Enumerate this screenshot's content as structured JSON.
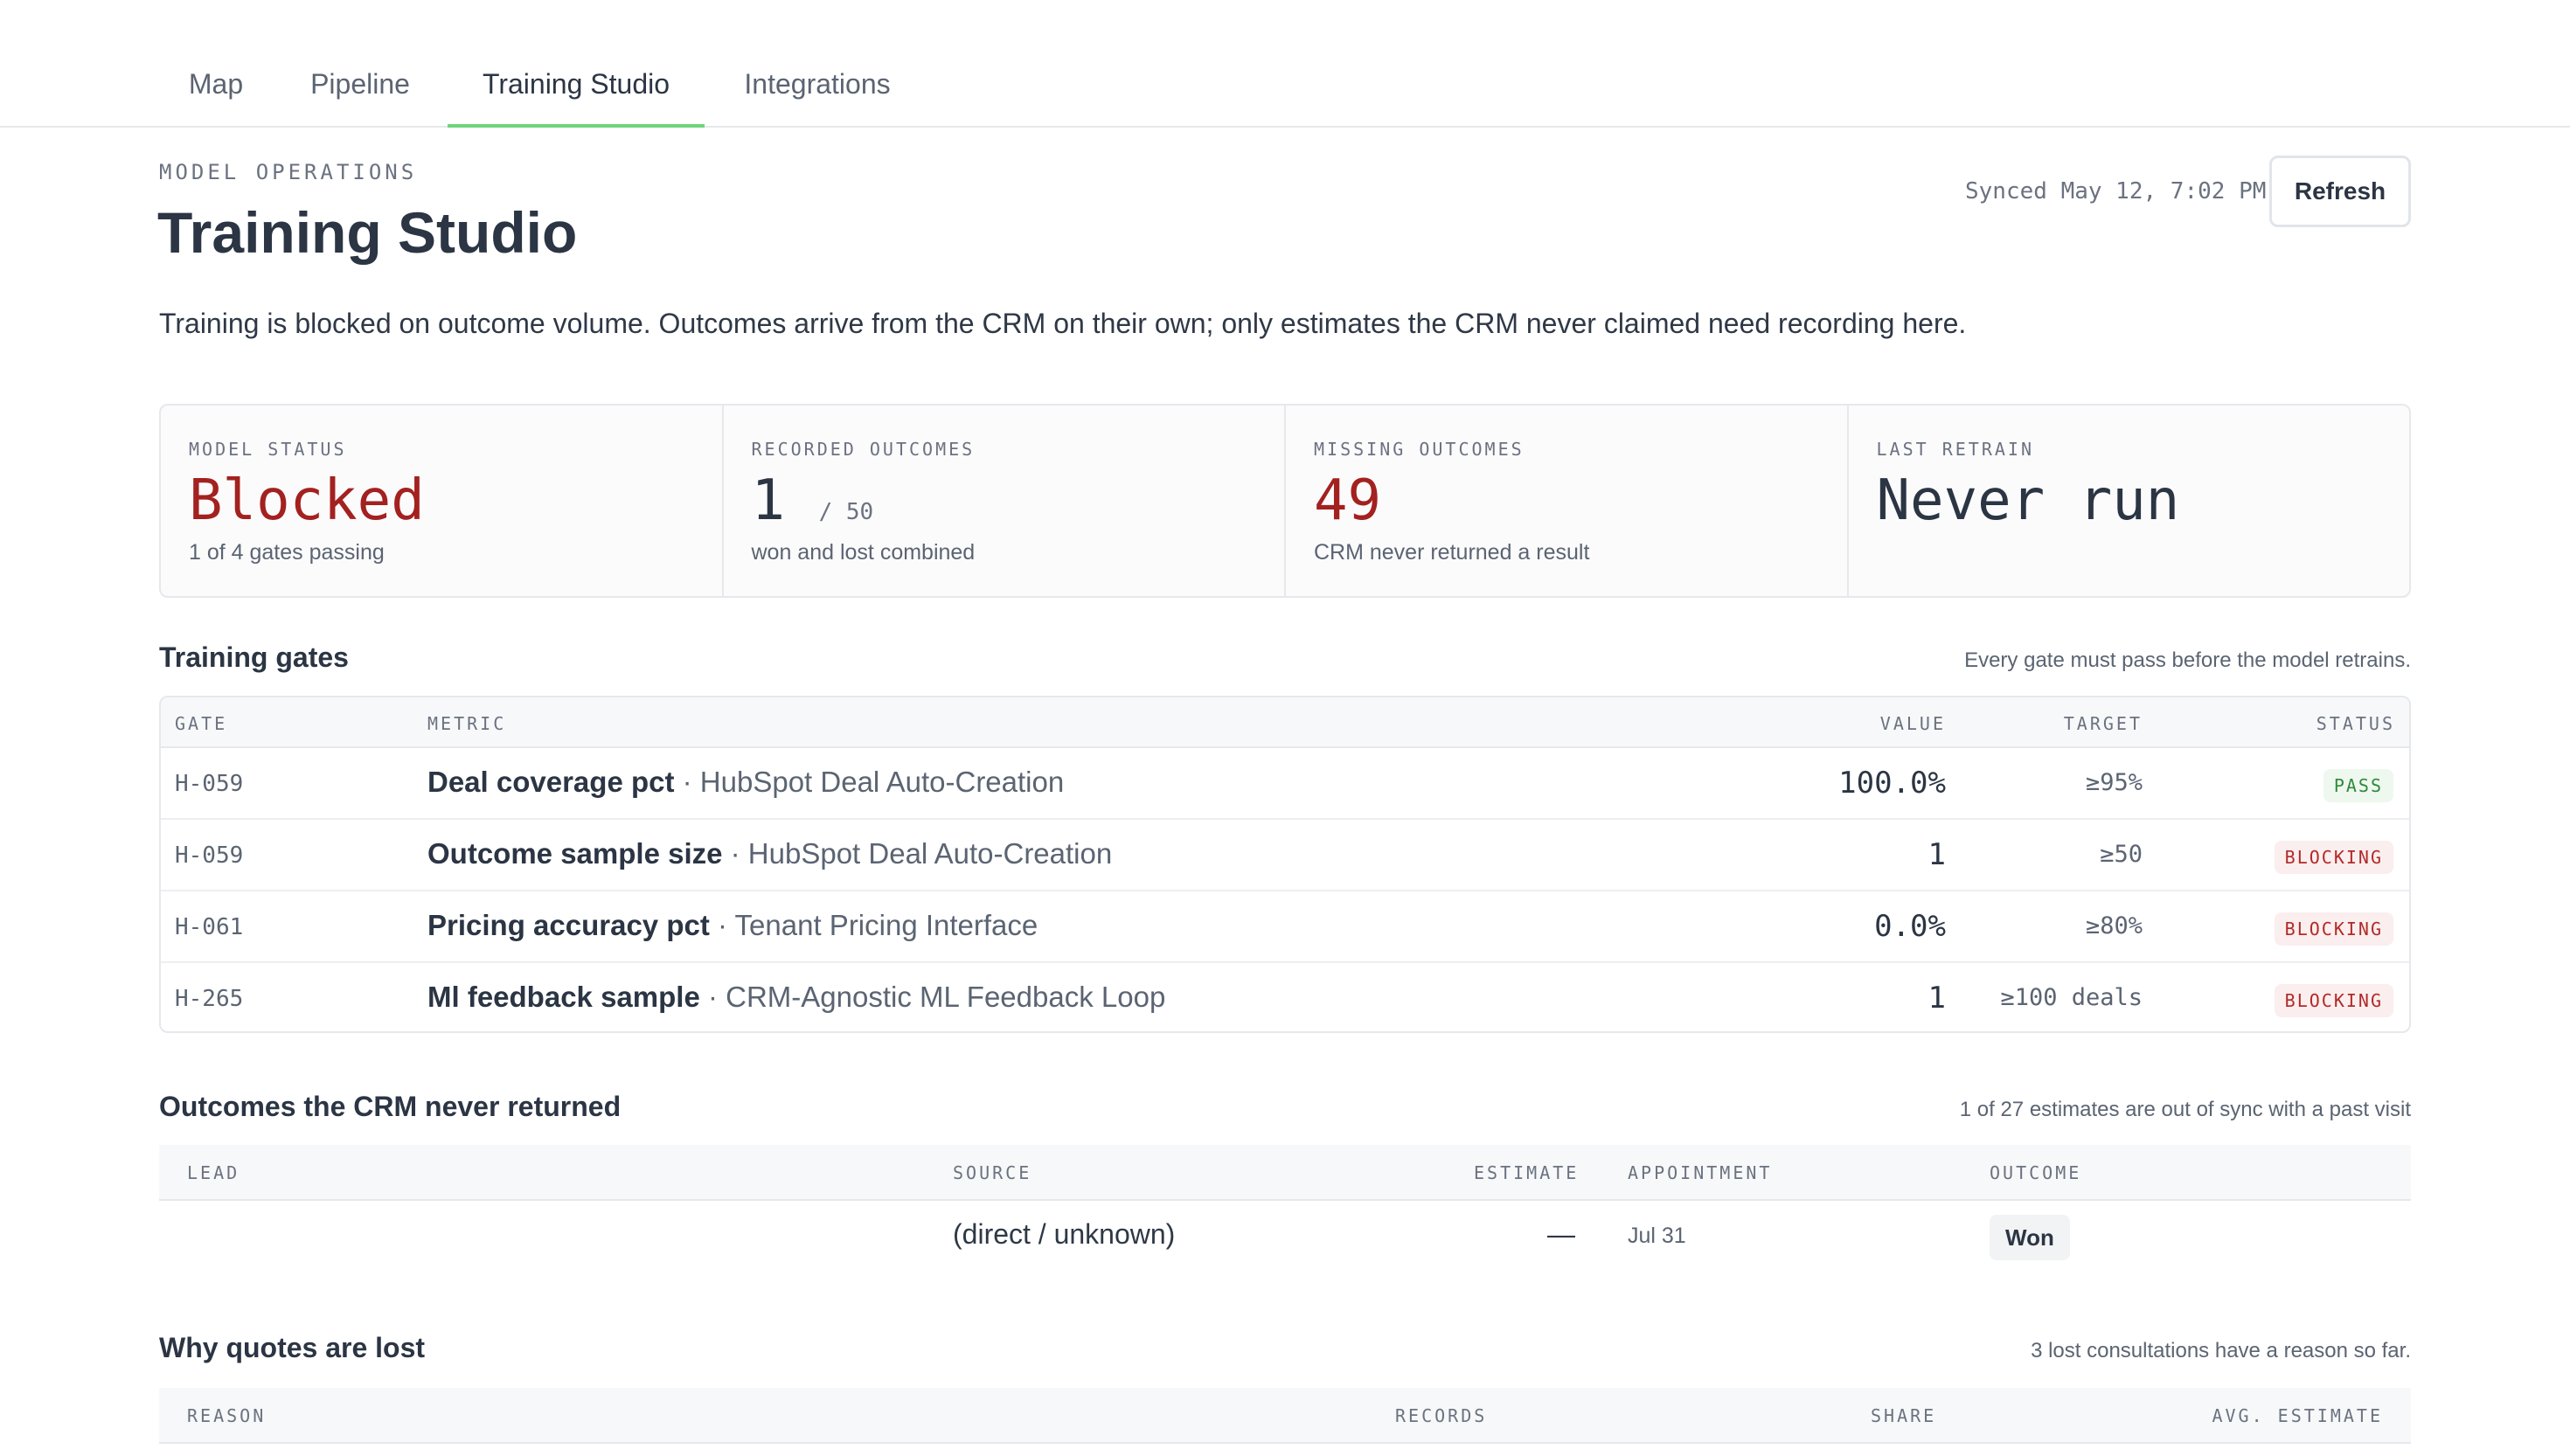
{
  "tabs": [
    {
      "label": "Map",
      "active": false
    },
    {
      "label": "Pipeline",
      "active": false
    },
    {
      "label": "Training Studio",
      "active": true
    },
    {
      "label": "Integrations",
      "active": false
    }
  ],
  "header": {
    "eyebrow": "MODEL OPERATIONS",
    "title": "Training Studio",
    "synced": "Synced May 12, 7:02 PM",
    "refresh_label": "Refresh",
    "subtitle": "Training is blocked on outcome volume. Outcomes arrive from the CRM on their own; only estimates the CRM never claimed need recording here."
  },
  "kpis": [
    {
      "label": "MODEL STATUS",
      "value": "Blocked",
      "suffix": "",
      "sub": "1 of 4 gates passing"
    },
    {
      "label": "RECORDED OUTCOMES",
      "value": "1",
      "suffix": "/ 50",
      "sub": "won and lost combined"
    },
    {
      "label": "MISSING OUTCOMES",
      "value": "49",
      "suffix": "",
      "sub": "CRM never returned a result"
    },
    {
      "label": "LAST RETRAIN",
      "value": "Never run",
      "suffix": "",
      "sub": ""
    }
  ],
  "gates": {
    "title": "Training gates",
    "note": "Every gate must pass before the model retrains.",
    "columns": [
      "GATE",
      "METRIC",
      "VALUE",
      "TARGET",
      "STATUS"
    ],
    "rows": [
      {
        "gate": "H-059",
        "metric": "Deal coverage pct",
        "source": "· HubSpot Deal Auto-Creation",
        "value": "100.0%",
        "target": "≥95%",
        "status": "PASS"
      },
      {
        "gate": "H-059",
        "metric": "Outcome sample size",
        "source": "· HubSpot Deal Auto-Creation",
        "value": "1",
        "target": "≥50",
        "status": "BLOCKING"
      },
      {
        "gate": "H-061",
        "metric": "Pricing accuracy pct",
        "source": "· Tenant Pricing Interface",
        "value": "0.0%",
        "target": "≥80%",
        "status": "BLOCKING"
      },
      {
        "gate": "H-265",
        "metric": "Ml feedback sample",
        "source": "· CRM-Agnostic ML Feedback Loop",
        "value": "1",
        "target": "≥100 deals",
        "status": "BLOCKING"
      }
    ]
  },
  "outcomes": {
    "title": "Outcomes the CRM never returned",
    "note": "1 of 27 estimates are out of sync with a past visit",
    "columns": [
      "LEAD",
      "SOURCE",
      "ESTIMATE",
      "APPOINTMENT",
      "OUTCOME"
    ],
    "rows": [
      {
        "lead": "",
        "source": "(direct / unknown)",
        "estimate": "—",
        "appointment": "Jul 31",
        "outcome": "Won"
      }
    ]
  },
  "lost": {
    "title": "Why quotes are lost",
    "note": "3 lost consultations have a reason so far.",
    "columns": [
      "REASON",
      "RECORDS",
      "SHARE",
      "AVG. ESTIMATE"
    ]
  },
  "colors": {
    "accent": "#6fd47a",
    "danger": "#a3211f",
    "pass": "#2f8a3a"
  }
}
